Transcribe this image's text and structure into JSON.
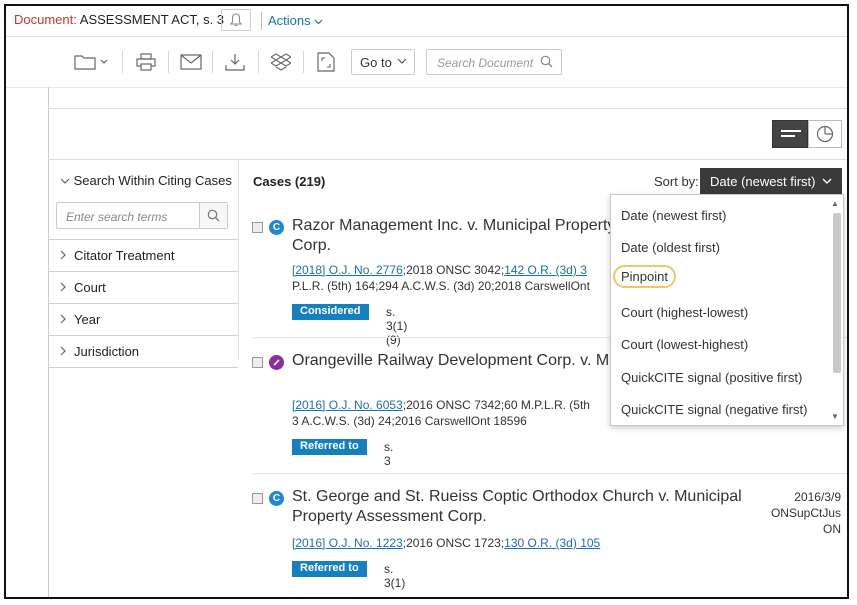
{
  "topbar": {
    "doc_prefix": "Document:",
    "doc_title": "ASSESSMENT ACT, s. 3",
    "actions_label": "Actions"
  },
  "toolbar": {
    "goto_label": "Go to",
    "search_placeholder": "Search Document"
  },
  "filters": {
    "heading": "Search Within Citing Cases",
    "search_placeholder": "Enter search terms",
    "items": [
      {
        "label": "Citator Treatment"
      },
      {
        "label": "Court"
      },
      {
        "label": "Year"
      },
      {
        "label": "Jurisdiction"
      }
    ]
  },
  "results": {
    "count_label": "Cases (219)",
    "sort_label": "Sort by:",
    "sort_value": "Date (newest first)",
    "cases": [
      {
        "title": "Razor Management Inc. v. Municipal Property Assessment Corp.",
        "cite_link1": "[2018] O.J. No. 2776",
        "cite_text1": ";2018 ONSC 3042;",
        "cite_link2": "142 O.R. (3d) 3",
        "cite_line2": "P.L.R. (5th) 164;294 A.C.W.S. (3d) 20;2018 CarswellOnt",
        "tag": "Considered",
        "section": "s. 3(1)(9)"
      },
      {
        "title": "Orangeville Railway Development Corp. v. Mississauga (City)",
        "cite_link1": "[2016] O.J. No. 6053",
        "cite_text1": ";2016 ONSC 7342;60 M.P.L.R. (5th",
        "cite_line2": "3 A.C.W.S. (3d) 24;2016 CarswellOnt 18596",
        "tag": "Referred to",
        "section": "s. 3"
      },
      {
        "title": "St. George and St. Rueiss Coptic Orthodox Church v. Municipal Property Assessment Corp.",
        "cite_link1": "[2016] O.J. No. 1223",
        "cite_text1": ";2016 ONSC 1723;",
        "cite_link2": "130 O.R. (3d) 105",
        "tag": "Referred to",
        "section": "s. 3(1)",
        "date": "2016/3/9",
        "court": "ONSupCtJus",
        "jurisdiction": "ON"
      }
    ]
  },
  "sort_options": [
    {
      "label": "Date (newest first)"
    },
    {
      "label": "Date (oldest first)"
    },
    {
      "label": "Pinpoint"
    },
    {
      "label": "Court (highest-lowest)"
    },
    {
      "label": "Court (lowest-highest)"
    },
    {
      "label": "QuickCITE signal (positive first)"
    },
    {
      "label": "QuickCITE signal (negative first)"
    }
  ],
  "colors": {
    "link": "#1a6fb5",
    "tag": "#1480be",
    "signal_blue": "#1e88d6",
    "signal_purple": "#8e2ba0",
    "highlight": "#f3c56b"
  }
}
